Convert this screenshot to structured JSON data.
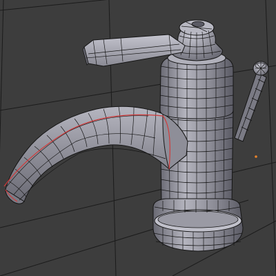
{
  "viewport": {
    "background": "#3d3d3d",
    "grid_color": "#1b1b1b"
  },
  "model": {
    "object": "faucet-mesh",
    "display_mode": "wireframe-over-solid",
    "mesh_color": "#9a9aa6",
    "edge_color": "#151515",
    "seam_color": "#d23a3a",
    "parts": [
      "lever-handle",
      "cap-knob",
      "upper-body",
      "spout",
      "lower-body",
      "base-ring",
      "side-rod",
      "rod-knob"
    ]
  },
  "origin_marker": {
    "color": "#e8832a"
  }
}
